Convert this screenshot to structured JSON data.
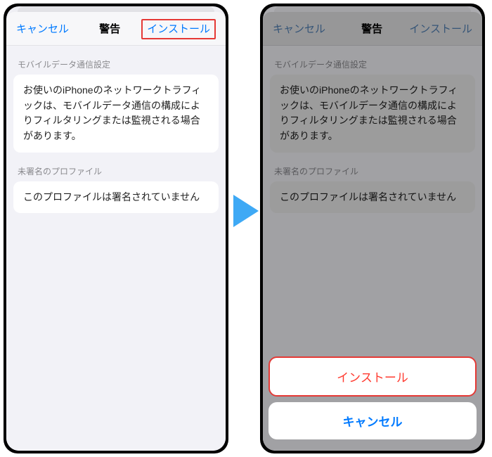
{
  "left": {
    "nav": {
      "cancel": "キャンセル",
      "title": "警告",
      "install": "インストール"
    },
    "section1": {
      "header": "モバイルデータ通信設定",
      "body": "お使いのiPhoneのネットワークトラフィックは、モバイルデータ通信の構成によりフィルタリングまたは監視される場合があります。"
    },
    "section2": {
      "header": "未署名のプロファイル",
      "body": "このプロファイルは署名されていません"
    }
  },
  "right": {
    "nav": {
      "cancel": "キャンセル",
      "title": "警告",
      "install": "インストール"
    },
    "section1": {
      "header": "モバイルデータ通信設定",
      "body": "お使いのiPhoneのネットワークトラフィックは、モバイルデータ通信の構成によりフィルタリングまたは監視される場合があります。"
    },
    "section2": {
      "header": "未署名のプロファイル",
      "body": "このプロファイルは署名されていません"
    },
    "actionsheet": {
      "install": "インストール",
      "cancel": "キャンセル"
    }
  }
}
